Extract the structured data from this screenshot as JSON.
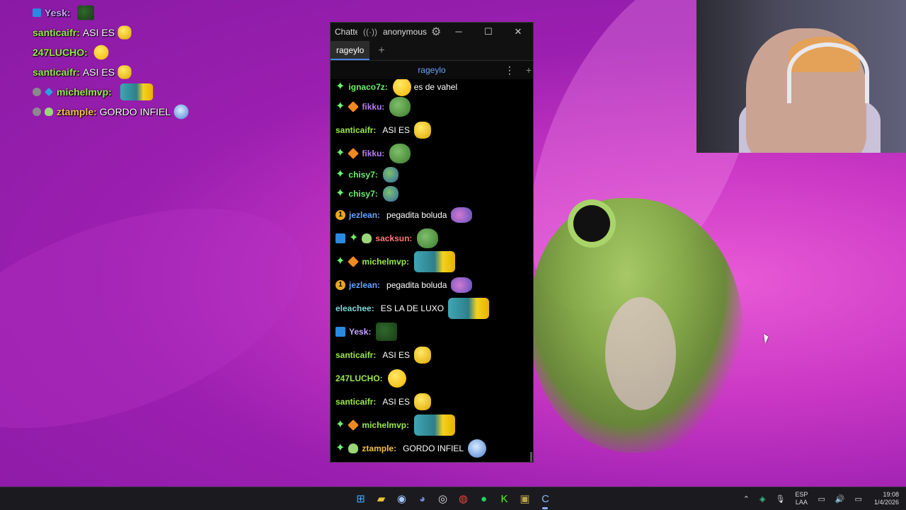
{
  "overlay_chat": [
    {
      "user": "Yesk",
      "color": "#c7a4ff",
      "badges": [
        "mod"
      ],
      "text": "",
      "emote": "pepe-dark"
    },
    {
      "user": "santicaifr",
      "color": "#9ae84d",
      "badges": [],
      "text": "ASI ES",
      "emote": "cool"
    },
    {
      "user": "247LUCHO",
      "color": "#9ae84d",
      "badges": [],
      "text": "",
      "emote": "yellow"
    },
    {
      "user": "santicaifr",
      "color": "#9ae84d",
      "badges": [],
      "text": "ASI ES",
      "emote": "cool"
    },
    {
      "user": "michelmvp",
      "color": "#9ae84d",
      "badges": [
        "dot",
        "gem"
      ],
      "text": "",
      "emote": "car"
    },
    {
      "user": "ztample",
      "color": "#f2c14a",
      "badges": [
        "dot",
        "alien"
      ],
      "text": "GORDO INFIEL",
      "emote": "blue"
    }
  ],
  "chat_window": {
    "app_title": "Chatterino",
    "user": "anonymous",
    "tab_label": "rageylo",
    "channel": "rageylo",
    "messages": [
      {
        "user": "ignaco7z",
        "color": "#6ef06e",
        "badges": [
          "sparkle"
        ],
        "text": "es de vahel",
        "emotes": [
          "yellow"
        ]
      },
      {
        "user": "fikku",
        "color": "#b67cf2",
        "badges": [
          "sparkle",
          "prime"
        ],
        "text": "",
        "emotes": [
          "pepe"
        ]
      },
      {
        "user": "santicaifr",
        "color": "#9ae84d",
        "badges": [],
        "text": "ASI ES",
        "emotes": [
          "cool"
        ]
      },
      {
        "user": "fikku",
        "color": "#b67cf2",
        "badges": [
          "sparkle",
          "prime"
        ],
        "text": "",
        "emotes": [
          "pepe"
        ]
      },
      {
        "user": "chisy7",
        "color": "#6ef06e",
        "badges": [
          "sparkle"
        ],
        "text": "",
        "emotes": [
          "pepe-sm"
        ]
      },
      {
        "user": "chisy7",
        "color": "#6ef06e",
        "badges": [
          "sparkle"
        ],
        "text": "",
        "emotes": [
          "pepe-sm"
        ]
      },
      {
        "user": "jezlean",
        "color": "#6aa4ff",
        "badges": [
          "one"
        ],
        "text": "pegadita boluda",
        "emotes": [
          "frogtongue"
        ]
      },
      {
        "user": "sacksun",
        "color": "#ff7a7a",
        "badges": [
          "mod",
          "sparkle",
          "alien"
        ],
        "text": "",
        "emotes": [
          "pepe"
        ]
      },
      {
        "user": "michelmvp",
        "color": "#9ae84d",
        "badges": [
          "sparkle",
          "prime"
        ],
        "text": "",
        "emotes": [
          "car"
        ]
      },
      {
        "user": "jezlean",
        "color": "#6aa4ff",
        "badges": [
          "one"
        ],
        "text": "pegadita boluda",
        "emotes": [
          "frogtongue"
        ]
      },
      {
        "user": "eleachee",
        "color": "#7fd8d8",
        "badges": [],
        "text": "ES LA DE LUXO",
        "emotes": [
          "car"
        ]
      },
      {
        "user": "Yesk",
        "color": "#c7a4ff",
        "badges": [
          "mod"
        ],
        "text": "",
        "emotes": [
          "pepe-dark"
        ]
      },
      {
        "user": "santicaifr",
        "color": "#9ae84d",
        "badges": [],
        "text": "ASI ES",
        "emotes": [
          "cool"
        ]
      },
      {
        "user": "247LUCHO",
        "color": "#9ae84d",
        "badges": [],
        "text": "",
        "emotes": [
          "yellow"
        ]
      },
      {
        "user": "santicaifr",
        "color": "#9ae84d",
        "badges": [],
        "text": "ASI ES",
        "emotes": [
          "cool"
        ]
      },
      {
        "user": "michelmvp",
        "color": "#9ae84d",
        "badges": [
          "sparkle",
          "prime"
        ],
        "text": "",
        "emotes": [
          "car"
        ]
      },
      {
        "user": "ztample",
        "color": "#f2c14a",
        "badges": [
          "sparkle",
          "alien"
        ],
        "text": "GORDO INFIEL",
        "emotes": [
          "blue"
        ]
      }
    ]
  },
  "taskbar": {
    "apps": [
      {
        "name": "windows-start",
        "glyph": "⊞",
        "color": "#4aa8ff"
      },
      {
        "name": "file-explorer",
        "glyph": "▰",
        "color": "#f4c430"
      },
      {
        "name": "steam",
        "glyph": "◉",
        "color": "#a8c8ff"
      },
      {
        "name": "discord",
        "glyph": "◕",
        "color": "#7289da"
      },
      {
        "name": "obs",
        "glyph": "◎",
        "color": "#dddddd"
      },
      {
        "name": "chrome",
        "glyph": "◍",
        "color": "#e8453c"
      },
      {
        "name": "spotify",
        "glyph": "●",
        "color": "#1ed760"
      },
      {
        "name": "kick",
        "glyph": "K",
        "color": "#53fc18"
      },
      {
        "name": "wallpaper-app",
        "glyph": "▣",
        "color": "#b8a24a"
      },
      {
        "name": "chatterino",
        "glyph": "C",
        "color": "#8ab4f8",
        "active": true
      }
    ],
    "ime_lang": "ESP",
    "ime_layout": "LAA",
    "time": "19:08",
    "date": "1/4/2026"
  }
}
